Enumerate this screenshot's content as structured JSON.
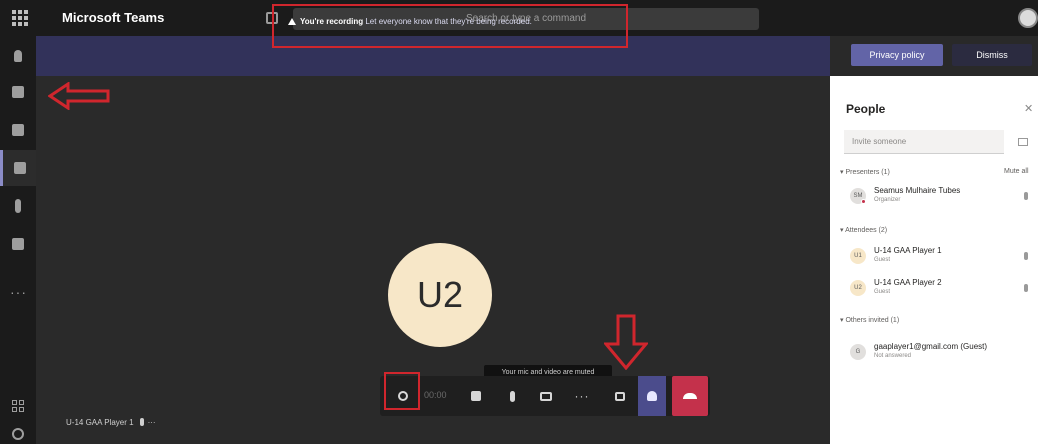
{
  "app": {
    "name": "Microsoft Teams"
  },
  "search": {
    "placeholder": "Search or type a command"
  },
  "banner": {
    "title": "You're recording",
    "message": "Let everyone know that they're being recorded.",
    "privacy_label": "Privacy policy",
    "dismiss_label": "Dismiss"
  },
  "stage": {
    "participant_initials": "U2",
    "timer": "00:00",
    "tooltip": "Your mic and video are muted",
    "self_label": "U-14 GAA Player 1",
    "self_more": "···"
  },
  "people": {
    "title": "People",
    "close": "✕",
    "invite_placeholder": "Invite someone",
    "mute_all": "Mute all",
    "sections": {
      "presenters": "Presenters (1)",
      "attendees": "Attendees (2)",
      "others": "Others invited (1)"
    },
    "presenters": [
      {
        "name": "Seamus Mulhaire Tubes",
        "role": "Organizer",
        "initials": "SM",
        "avatar_color": "#e1dfdd"
      }
    ],
    "attendees": [
      {
        "name": "U-14 GAA Player 1",
        "role": "Guest",
        "initials": "U1",
        "avatar_color": "#f7e7c8"
      },
      {
        "name": "U-14 GAA Player 2",
        "role": "Guest",
        "initials": "U2",
        "avatar_color": "#f7e7c8"
      }
    ],
    "others": [
      {
        "name": "gaaplayer1@gmail.com (Guest)",
        "role": "Not answered",
        "initials": "G",
        "avatar_color": "#e1dfdd"
      }
    ]
  },
  "colors": {
    "accent": "#6264a7",
    "banner_bg": "#32325a",
    "leave": "#c4314b",
    "highlight": "#d0262d"
  }
}
